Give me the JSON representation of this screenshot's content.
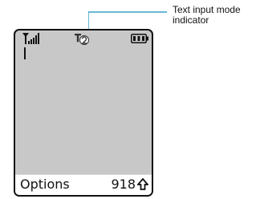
{
  "callout": {
    "line1": "Text input mode",
    "line2": "indicator"
  },
  "screen": {
    "icons": {
      "signal": "signal-strength-icon",
      "mode": "text-input-mode-icon",
      "battery": "battery-icon",
      "shift": "shift-arrow-icon"
    },
    "softkeys": {
      "left": "Options",
      "right": "918"
    },
    "colors": {
      "screen_background": "#c8c8c8",
      "softkey_background": "#ffffff",
      "outline": "#111111",
      "leader_line": "#35a0c8"
    }
  }
}
